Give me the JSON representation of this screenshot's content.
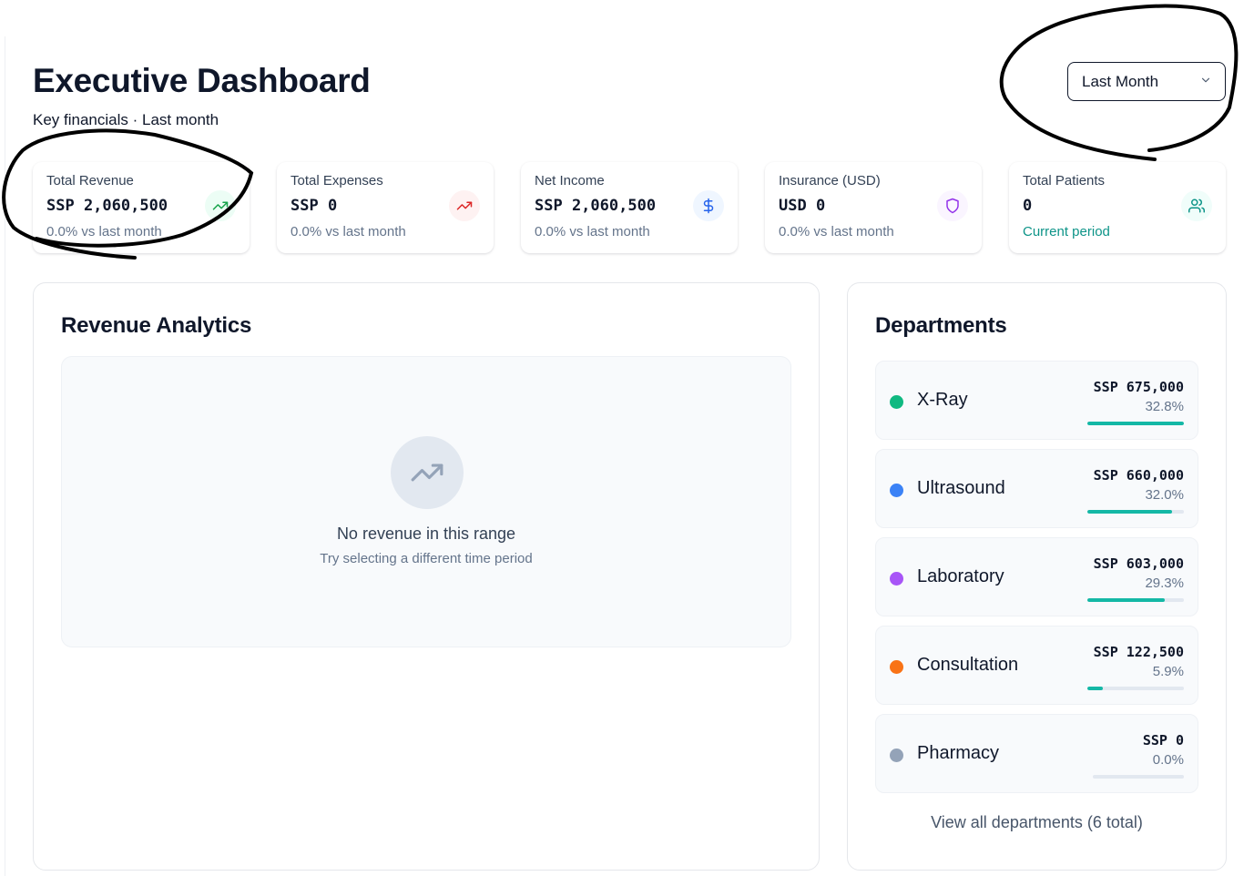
{
  "header": {
    "title": "Executive Dashboard",
    "subtitle": "Key financials · Last month",
    "period_selected": "Last Month"
  },
  "kpis": [
    {
      "label": "Total Revenue",
      "value": "SSP 2,060,500",
      "change": "0.0% vs last month",
      "icon": "trending-up-icon",
      "icon_color": "#16a34a",
      "icon_bg": "#ecfdf5"
    },
    {
      "label": "Total Expenses",
      "value": "SSP 0",
      "change": "0.0% vs last month",
      "icon": "trending-up-icon",
      "icon_color": "#dc2626",
      "icon_bg": "#fef2f2"
    },
    {
      "label": "Net Income",
      "value": "SSP 2,060,500",
      "change": "0.0% vs last month",
      "icon": "dollar-icon",
      "icon_color": "#2563eb",
      "icon_bg": "#eff6ff"
    },
    {
      "label": "Insurance (USD)",
      "value": "USD 0",
      "change": "0.0% vs last month",
      "icon": "shield-icon",
      "icon_color": "#9333ea",
      "icon_bg": "#faf5ff"
    },
    {
      "label": "Total Patients",
      "value": "0",
      "change": "Current period",
      "icon": "users-icon",
      "icon_color": "#0d9488",
      "icon_bg": "#f0fdfa"
    }
  ],
  "revenue_analytics": {
    "title": "Revenue Analytics",
    "empty_title": "No revenue in this range",
    "empty_subtitle": "Try selecting a different time period",
    "empty_icon": "trending-up-icon"
  },
  "departments": {
    "title": "Departments",
    "items": [
      {
        "name": "X-Ray",
        "amount": "SSP 675,000",
        "percent": "32.8%",
        "share": 0.328,
        "color": "#10b981"
      },
      {
        "name": "Ultrasound",
        "amount": "SSP 660,000",
        "percent": "32.0%",
        "share": 0.32,
        "color": "#3b82f6"
      },
      {
        "name": "Laboratory",
        "amount": "SSP 603,000",
        "percent": "29.3%",
        "share": 0.293,
        "color": "#a855f7"
      },
      {
        "name": "Consultation",
        "amount": "SSP 122,500",
        "percent": "5.9%",
        "share": 0.059,
        "color": "#f97316"
      },
      {
        "name": "Pharmacy",
        "amount": "SSP 0",
        "percent": "0.0%",
        "share": 0.0,
        "color": "#94a3b8"
      }
    ],
    "view_all": "View all departments (6 total)",
    "bar_color": "#14b8a6"
  }
}
